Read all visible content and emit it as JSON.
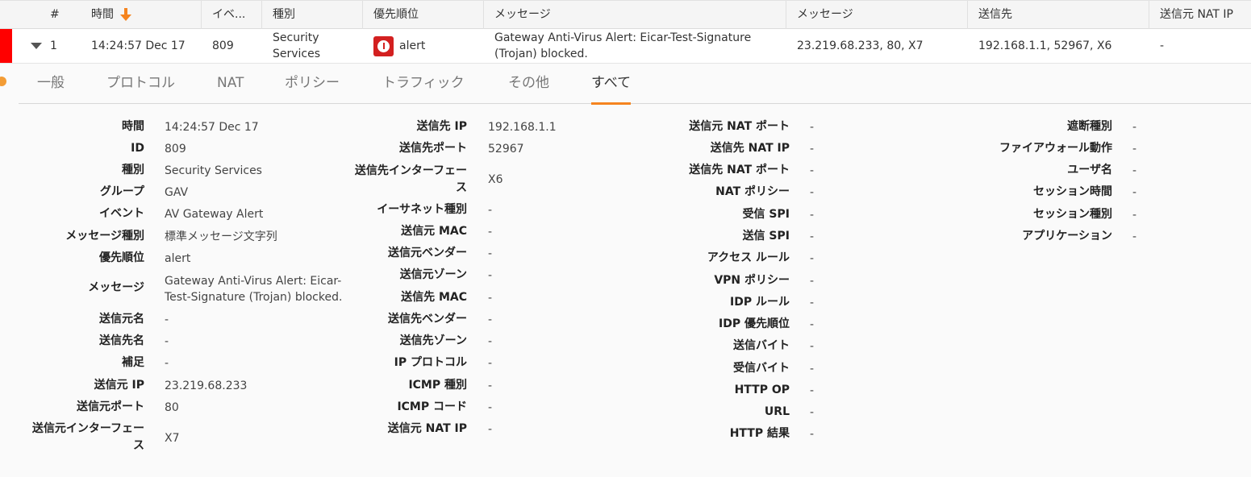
{
  "header": {
    "cols": [
      "#",
      "時間",
      "イベ...",
      "種別",
      "優先順位",
      "メッセージ",
      "メッセージ",
      "送信先",
      "送信元 NAT IP"
    ]
  },
  "row": {
    "num": "1",
    "time": "14:24:57 Dec 17",
    "event": "809",
    "category_l1": "Security",
    "category_l2": "Services",
    "priority": "alert",
    "message_l1": "Gateway Anti-Virus Alert: Eicar-Test-Signature",
    "message_l2": "(Trojan) blocked.",
    "source": "23.219.68.233, 80, X7",
    "destination": "192.168.1.1, 52967, X6",
    "src_nat_ip": "-"
  },
  "tabs": [
    "一般",
    "プロトコル",
    "NAT",
    "ポリシー",
    "トラフィック",
    "その他",
    "すべて"
  ],
  "col1": [
    {
      "k": "時間",
      "v": "14:24:57 Dec 17"
    },
    {
      "k": "ID",
      "v": "809"
    },
    {
      "k": "種別",
      "v": "Security Services"
    },
    {
      "k": "グループ",
      "v": "GAV"
    },
    {
      "k": "イベント",
      "v": "AV Gateway Alert"
    },
    {
      "k": "メッセージ種別",
      "v": "標準メッセージ文字列"
    },
    {
      "k": "優先順位",
      "v": "alert"
    },
    {
      "k": "メッセージ",
      "v1": "Gateway Anti-Virus Alert: Eicar-",
      "v2": "Test-Signature (Trojan) blocked."
    },
    {
      "k": "送信元名",
      "v": "-"
    },
    {
      "k": "送信先名",
      "v": "-"
    },
    {
      "k": "補足",
      "v": "-"
    },
    {
      "k": "送信元 IP",
      "v": "23.219.68.233"
    },
    {
      "k": "送信元ポート",
      "v": "80"
    },
    {
      "k1": "送信元インターフェー",
      "k2": "ス",
      "v": "X7"
    }
  ],
  "col2": [
    {
      "k": "送信先 IP",
      "v": "192.168.1.1"
    },
    {
      "k": "送信先ポート",
      "v": "52967"
    },
    {
      "k1": "送信先インターフェー",
      "k2": "ス",
      "v": "X6"
    },
    {
      "k": "イーサネット種別",
      "v": "-"
    },
    {
      "k": "送信元 MAC",
      "v": "-"
    },
    {
      "k": "送信元ベンダー",
      "v": "-"
    },
    {
      "k": "送信元ゾーン",
      "v": "-"
    },
    {
      "k": "送信先 MAC",
      "v": "-"
    },
    {
      "k": "送信先ベンダー",
      "v": "-"
    },
    {
      "k": "送信先ゾーン",
      "v": "-"
    },
    {
      "k": "IP プロトコル",
      "v": "-"
    },
    {
      "k": "ICMP 種別",
      "v": "-"
    },
    {
      "k": "ICMP コード",
      "v": "-"
    },
    {
      "k": "送信元 NAT IP",
      "v": "-"
    }
  ],
  "col3": [
    {
      "k": "送信元 NAT ポート",
      "v": "-"
    },
    {
      "k": "送信先 NAT IP",
      "v": "-"
    },
    {
      "k": "送信先 NAT ポート",
      "v": "-"
    },
    {
      "k": "NAT ポリシー",
      "v": "-"
    },
    {
      "k": "受信 SPI",
      "v": "-"
    },
    {
      "k": "送信 SPI",
      "v": "-"
    },
    {
      "k": "アクセス ルール",
      "v": "-"
    },
    {
      "k": "VPN ポリシー",
      "v": "-"
    },
    {
      "k": "IDP ルール",
      "v": "-"
    },
    {
      "k": "IDP 優先順位",
      "v": "-"
    },
    {
      "k": "送信バイト",
      "v": "-"
    },
    {
      "k": "受信バイト",
      "v": "-"
    },
    {
      "k": "HTTP OP",
      "v": "-"
    },
    {
      "k": "URL",
      "v": "-"
    },
    {
      "k": "HTTP 結果",
      "v": "-"
    }
  ],
  "col4": [
    {
      "k": "遮断種別",
      "v": "-"
    },
    {
      "k": "ファイアウォール動作",
      "v": "-"
    },
    {
      "k": "ユーザ名",
      "v": "-"
    },
    {
      "k": "セッション時間",
      "v": "-"
    },
    {
      "k": "セッション種別",
      "v": "-"
    },
    {
      "k": "アプリケーション",
      "v": "-"
    }
  ]
}
